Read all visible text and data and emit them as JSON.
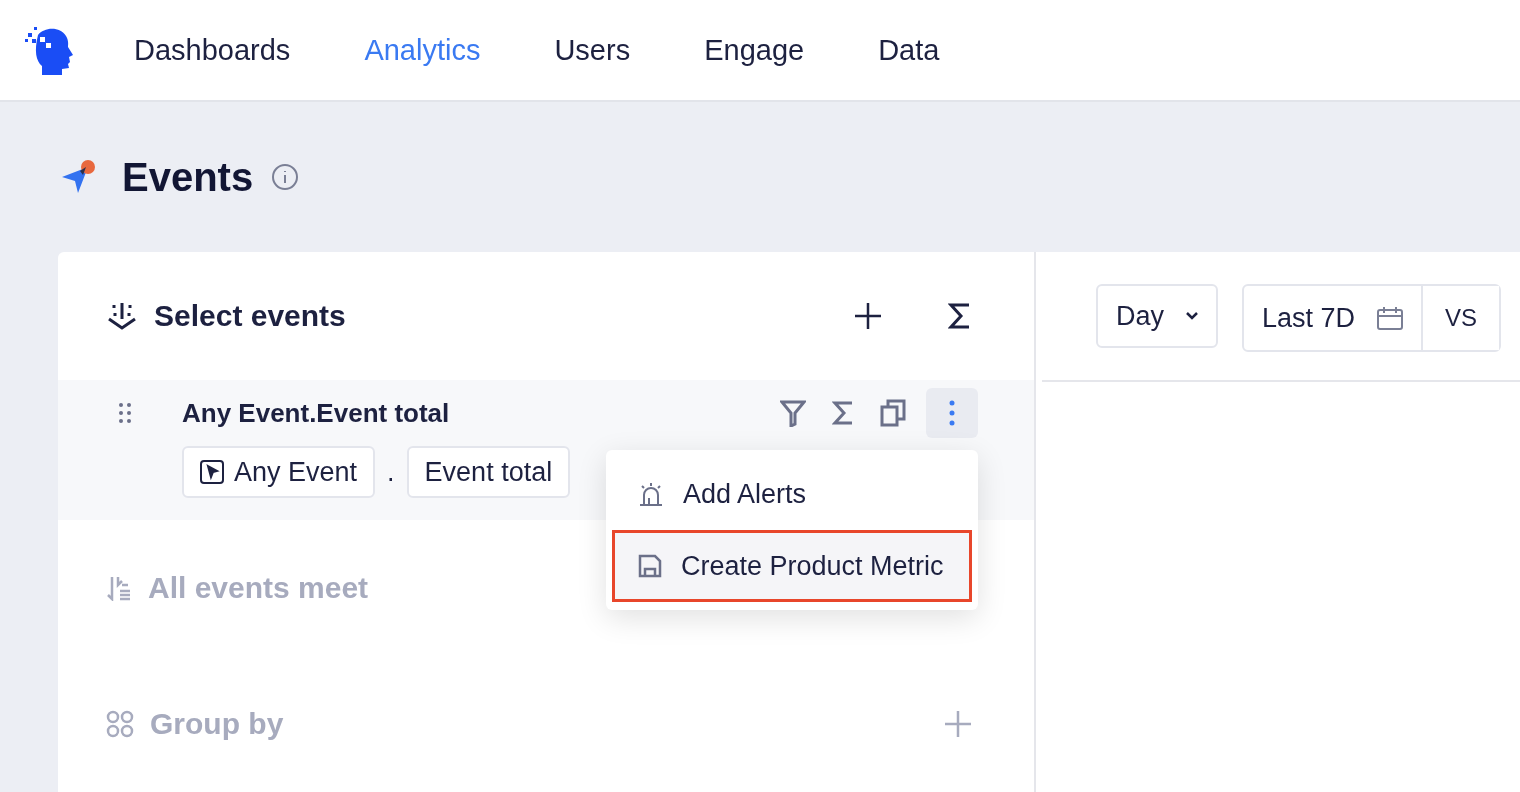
{
  "nav": {
    "items": [
      {
        "label": "Dashboards",
        "selected": false
      },
      {
        "label": "Analytics",
        "selected": true
      },
      {
        "label": "Users",
        "selected": false
      },
      {
        "label": "Engage",
        "selected": false
      },
      {
        "label": "Data",
        "selected": false
      }
    ]
  },
  "page": {
    "title": "Events"
  },
  "query": {
    "title": "Select events",
    "events": [
      {
        "name": "Any Event.Event total",
        "event": "Any Event",
        "separator": ".",
        "measure": "Event total",
        "menu_open": true
      }
    ],
    "menu": [
      {
        "label": "Add Alerts",
        "kind": "alert",
        "highlighted": false
      },
      {
        "label": "Create Product Metric",
        "kind": "save",
        "highlighted": true
      }
    ],
    "conditions": {
      "label": "All events meet"
    },
    "group_by": {
      "label": "Group by"
    }
  },
  "controls": {
    "interval": "Day",
    "range": "Last 7D",
    "compare": "VS"
  }
}
